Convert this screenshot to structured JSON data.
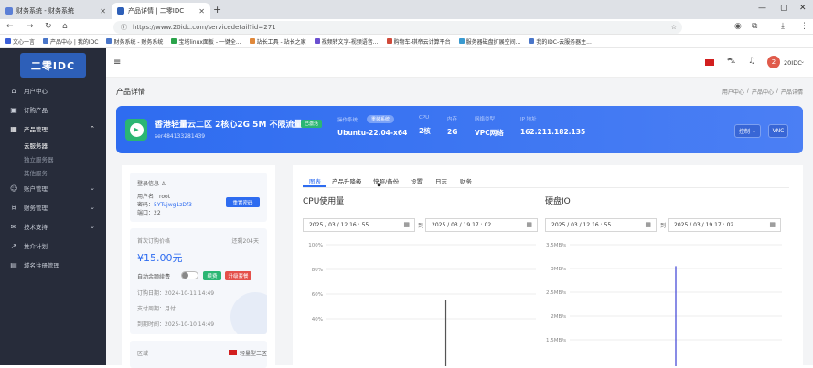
{
  "browser": {
    "tabs": [
      {
        "title": "财务系统 - 财务系统"
      },
      {
        "title": "产品详情 | 二零IDC"
      }
    ],
    "url": "https://www.20idc.com/servicedetail?id=271",
    "bookmarks": [
      "文心一言",
      "产品中心 | 我的IDC",
      "财务系统 - 财务系统",
      "宝塔linux面板 - 一键全...",
      "站长工具 - 站长之家",
      "视频转文字-视频语音...",
      "购物车-琪帝云计算平台",
      "服务器磁盘扩展空间...",
      "我的IDC-云服务器主..."
    ]
  },
  "sidebar": {
    "logo_text": "二零IDC",
    "items": [
      {
        "label": "用户中心",
        "icon": "dashboard-icon"
      },
      {
        "label": "订购产品",
        "icon": "cart-icon"
      },
      {
        "label": "产品管理",
        "icon": "box-icon",
        "expanded": true
      },
      {
        "label": "账户管理",
        "icon": "user-icon"
      },
      {
        "label": "财务管理",
        "icon": "wallet-icon"
      },
      {
        "label": "技术支持",
        "icon": "support-icon"
      },
      {
        "label": "推介计划",
        "icon": "share-icon"
      },
      {
        "label": "域名注册管理",
        "icon": "domain-icon"
      }
    ],
    "subitems": [
      "云服务器",
      "独立服务器",
      "其他服务"
    ]
  },
  "header": {
    "user": "20IDC",
    "avatar_text": "2"
  },
  "page": {
    "title": "产品详情",
    "breadcrumb": [
      "用户中心",
      "产品中心",
      "产品详情"
    ]
  },
  "banner": {
    "product_name": "香港轻量云二区 2核心2G 5M 不限流量",
    "status": "已激活",
    "service_id": "ser484133281439",
    "os_label": "操作系统",
    "reinstall": "重装系统",
    "os_value": "Ubuntu-22.04-x64",
    "cpu_label": "CPU",
    "cpu_value": "2核",
    "mem_label": "内存",
    "mem_value": "2G",
    "net_label": "网络类型",
    "net_value": "VPC网络",
    "ip_label": "IP 地址",
    "ip_value": "162.211.182.135",
    "control_btn": "控制",
    "vnc_btn": "VNC"
  },
  "login": {
    "title": "登录信息",
    "user_label": "用户名：",
    "user_value": "root",
    "pwd_label": "密码：",
    "pwd_value": "5YTujwg1zDf3",
    "port_label": "端口：",
    "port_value": "22",
    "reset_btn": "重置密码"
  },
  "billing": {
    "price_label": "首次订购价格",
    "remain": "还剩204天",
    "price": "¥15.00元",
    "autorenew_label": "自动余额续费",
    "renew_btn": "续费",
    "upgrade_btn": "升级套餐",
    "order_date_label": "订购日期：",
    "order_date": "2024-10-11 14:49",
    "cycle_label": "支付周期：",
    "cycle": "月付",
    "expire_label": "到期时间：",
    "expire": "2025-10-10 14:49",
    "region_label": "区域",
    "region_value": "轻量型二区"
  },
  "tabs": [
    "图表",
    "产品升降级",
    "快照/备份",
    "设置",
    "日志",
    "财务"
  ],
  "charts": {
    "cpu_title": "CPU使用量",
    "disk_title": "硬盘IO",
    "date_from": "2025 / 03 / 12  16 : 55",
    "date_to": "2025 / 03 / 19  17 : 02",
    "date_sep": "到"
  },
  "chart_data": [
    {
      "type": "line",
      "title": "CPU使用量",
      "yticks": [
        "100%",
        "80%",
        "60%",
        "40%"
      ],
      "ylim": [
        40,
        100
      ],
      "x": [
        "2025-03-12 16:55",
        "2025-03-19 17:02"
      ],
      "series": [
        {
          "values": [
            0,
            0,
            0,
            55,
            0,
            0,
            0
          ]
        }
      ]
    },
    {
      "type": "line",
      "title": "硬盘IO",
      "yticks": [
        "3.5MB/s",
        "3MB/s",
        "2.5MB/s",
        "2MB/s",
        "1.5MB/s"
      ],
      "ylim": [
        1.5,
        3.5
      ],
      "x": [
        "2025-03-12 16:55",
        "2025-03-19 17:02"
      ],
      "series": [
        {
          "values": [
            0,
            0,
            0,
            3.05,
            0,
            0,
            0
          ]
        }
      ]
    }
  ]
}
